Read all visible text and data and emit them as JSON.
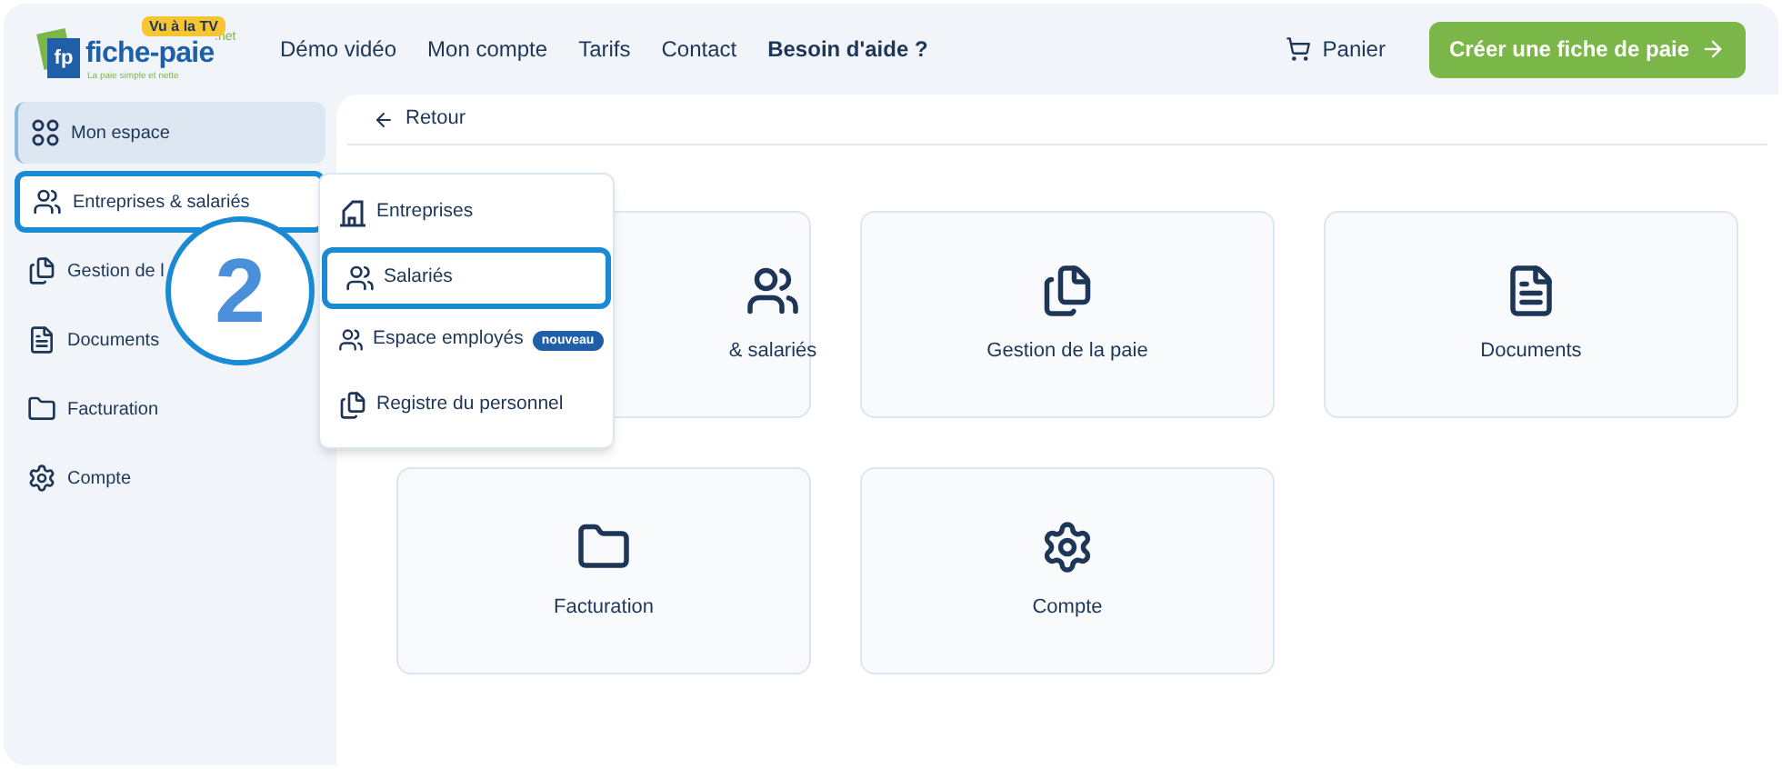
{
  "header": {
    "logo": {
      "mark": "fp",
      "name": "fiche-paie",
      "suffix": ".net",
      "badge": "Vu à la TV",
      "tagline": "La paie simple et nette"
    },
    "nav": [
      {
        "label": "Démo vidéo",
        "bold": false
      },
      {
        "label": "Mon compte",
        "bold": false
      },
      {
        "label": "Tarifs",
        "bold": false
      },
      {
        "label": "Contact",
        "bold": false
      },
      {
        "label": "Besoin d'aide ?",
        "bold": true
      }
    ],
    "cart": "Panier",
    "cta": "Créer une fiche de paie"
  },
  "sidebar": {
    "items": [
      {
        "label": "Mon espace",
        "selected": true,
        "highlighted": false
      },
      {
        "label": "Entreprises & salariés",
        "selected": false,
        "highlighted": true
      },
      {
        "label": "Gestion de l",
        "selected": false,
        "highlighted": false
      },
      {
        "label": "Documents",
        "selected": false,
        "highlighted": false
      },
      {
        "label": "Facturation",
        "selected": false,
        "highlighted": false
      },
      {
        "label": "Compte",
        "selected": false,
        "highlighted": false
      }
    ]
  },
  "back": "Retour",
  "cards": [
    {
      "label": "& salariés"
    },
    {
      "label": "Gestion de la paie"
    },
    {
      "label": "Documents"
    },
    {
      "label": "Facturation"
    },
    {
      "label": "Compte"
    }
  ],
  "menu": {
    "items": [
      {
        "label": "Entreprises",
        "highlighted": false
      },
      {
        "label": "Salariés",
        "highlighted": true
      },
      {
        "label": "Espace employés",
        "highlighted": false,
        "badge": "nouveau"
      },
      {
        "label": "Registre du personnel",
        "highlighted": false
      }
    ]
  },
  "step": "2"
}
